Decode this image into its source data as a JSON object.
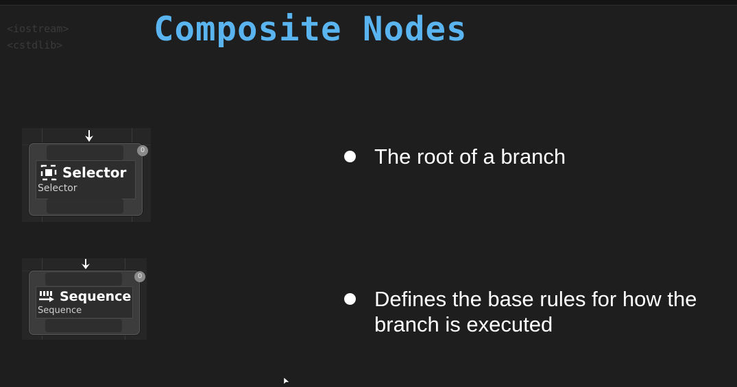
{
  "includes": [
    "<iostream>",
    "<cstdlib>"
  ],
  "title": "Composite Nodes",
  "nodes": {
    "selector": {
      "title": "Selector",
      "subtitle": "Selector",
      "badge": "0",
      "icon": "selector-icon"
    },
    "sequence": {
      "title": "Sequence",
      "subtitle": "Sequence",
      "badge": "0",
      "icon": "sequence-icon"
    }
  },
  "bullets": [
    {
      "lines": [
        "The root of a branch"
      ]
    },
    {
      "lines": [
        "Defines the base rules for how the",
        "branch is executed"
      ]
    }
  ],
  "colors": {
    "background": "#1e1e1e",
    "title": "#5ab4f0",
    "bullet_text": "#ffffff"
  }
}
